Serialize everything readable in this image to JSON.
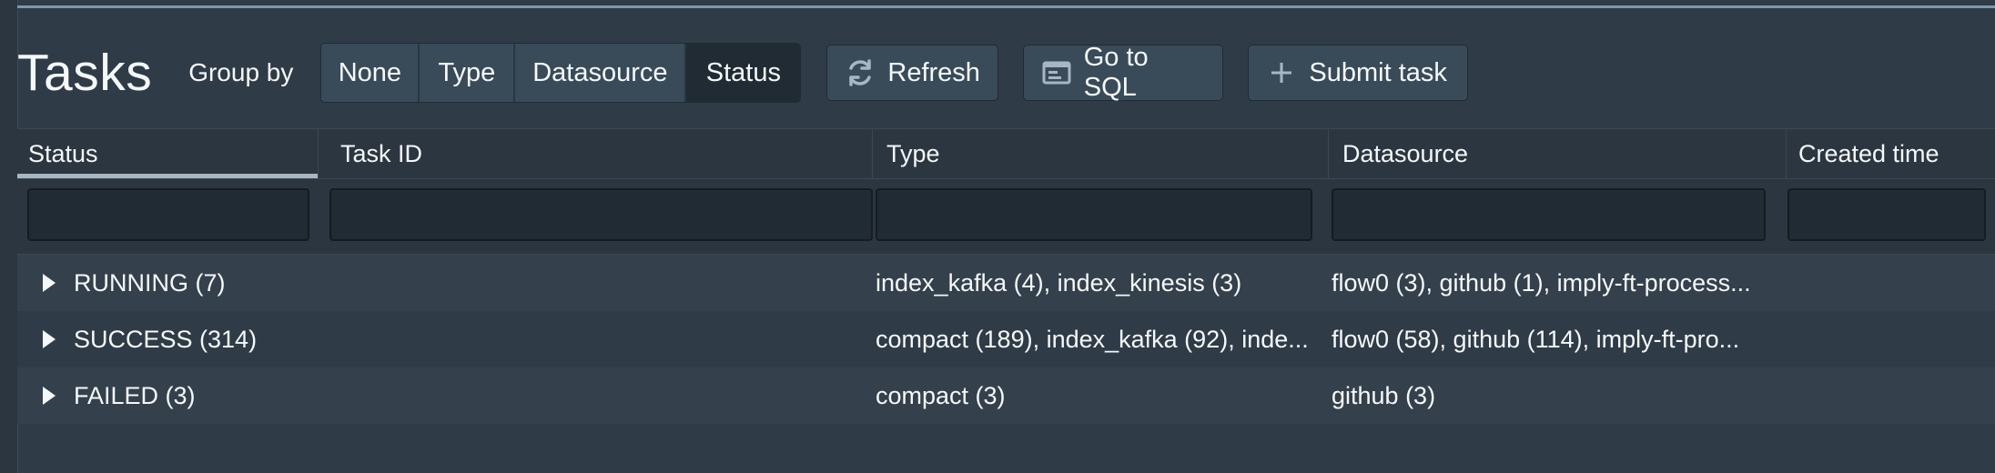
{
  "header": {
    "title": "Tasks",
    "group_by_label": "Group by",
    "group_options": [
      "None",
      "Type",
      "Datasource",
      "Status"
    ],
    "group_selected": "Status",
    "refresh_label": "Refresh",
    "sql_label": "Go to SQL",
    "submit_label": "Submit task"
  },
  "table": {
    "columns": [
      "Status",
      "Task ID",
      "Type",
      "Datasource",
      "Created time"
    ],
    "sorted_column": "Status",
    "rows": [
      {
        "status": "RUNNING (7)",
        "task_id": "",
        "type": "index_kafka (4), index_kinesis (3)",
        "datasource": "flow0 (3), github (1), imply-ft-process...",
        "created": ""
      },
      {
        "status": "SUCCESS (314)",
        "task_id": "",
        "type": "compact (189), index_kafka (92), inde...",
        "datasource": "flow0 (58), github (114), imply-ft-pro...",
        "created": ""
      },
      {
        "status": "FAILED (3)",
        "task_id": "",
        "type": "compact (3)",
        "datasource": "github (3)",
        "created": ""
      }
    ]
  },
  "colors": {
    "background": "#2f3b47",
    "button": "#394b59",
    "active_button": "#202b33",
    "sort_indicator": "#a7b6c2"
  },
  "icons": {
    "refresh": "refresh-icon",
    "sql": "application-icon",
    "submit": "plus-icon",
    "row_expand": "caret-right-icon"
  }
}
